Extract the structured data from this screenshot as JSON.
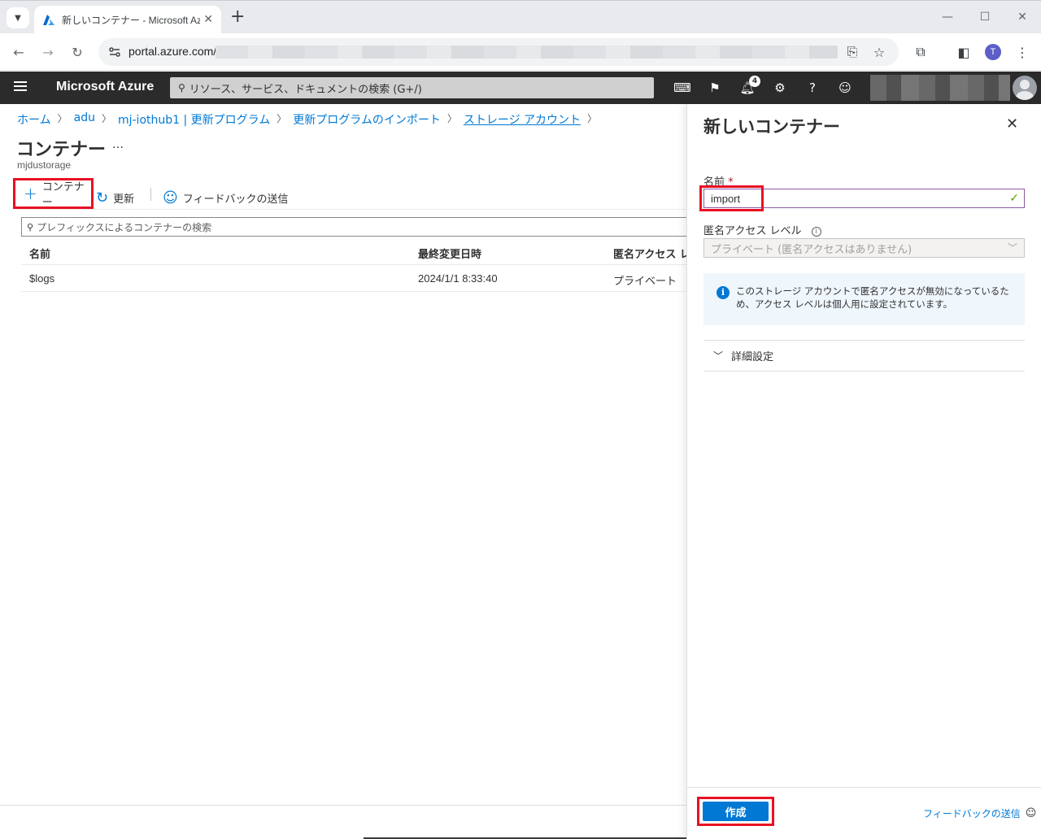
{
  "browser": {
    "tab_title": "新しいコンテナー - Microsoft Azure",
    "url": "portal.azure.com/",
    "profile_initial": "T"
  },
  "azure": {
    "brand": "Microsoft Azure",
    "search_placeholder": "リソース、サービス、ドキュメントの検索 (G+/)",
    "notification_count": "4"
  },
  "breadcrumb": [
    "ホーム",
    "adu",
    "mj-iothub1 | 更新プログラム",
    "更新プログラムのインポート",
    "ストレージ アカウント"
  ],
  "page": {
    "title": "コンテナー",
    "ellipsis": "…",
    "subtitle": "mjdustorage"
  },
  "toolbar": {
    "add_label": "コンテナー",
    "refresh_label": "更新",
    "feedback_label": "フィードバックの送信"
  },
  "filter": {
    "placeholder": "プレフィックスによるコンテナーの検索"
  },
  "table": {
    "headers": [
      "名前",
      "最終変更日時",
      "匿名アクセス レベ"
    ],
    "rows": [
      [
        "$logs",
        "2024/1/1 8:33:40",
        "プライベート"
      ]
    ]
  },
  "blade": {
    "title": "新しいコンテナー",
    "name_label": "名前",
    "required_mark": "*",
    "name_value": "import",
    "access_label": "匿名アクセス レベル",
    "access_value": "プライベート (匿名アクセスはありません)",
    "info_text": "このストレージ アカウントで匿名アクセスが無効になっているため、アクセス レベルは個人用に設定されています。",
    "advanced_label": "詳細設定",
    "create_label": "作成",
    "feedback_label": "フィードバックの送信"
  },
  "colors": {
    "accent": "#0078d4",
    "highlight": "#e81123",
    "topbar": "#2b2b2b"
  }
}
